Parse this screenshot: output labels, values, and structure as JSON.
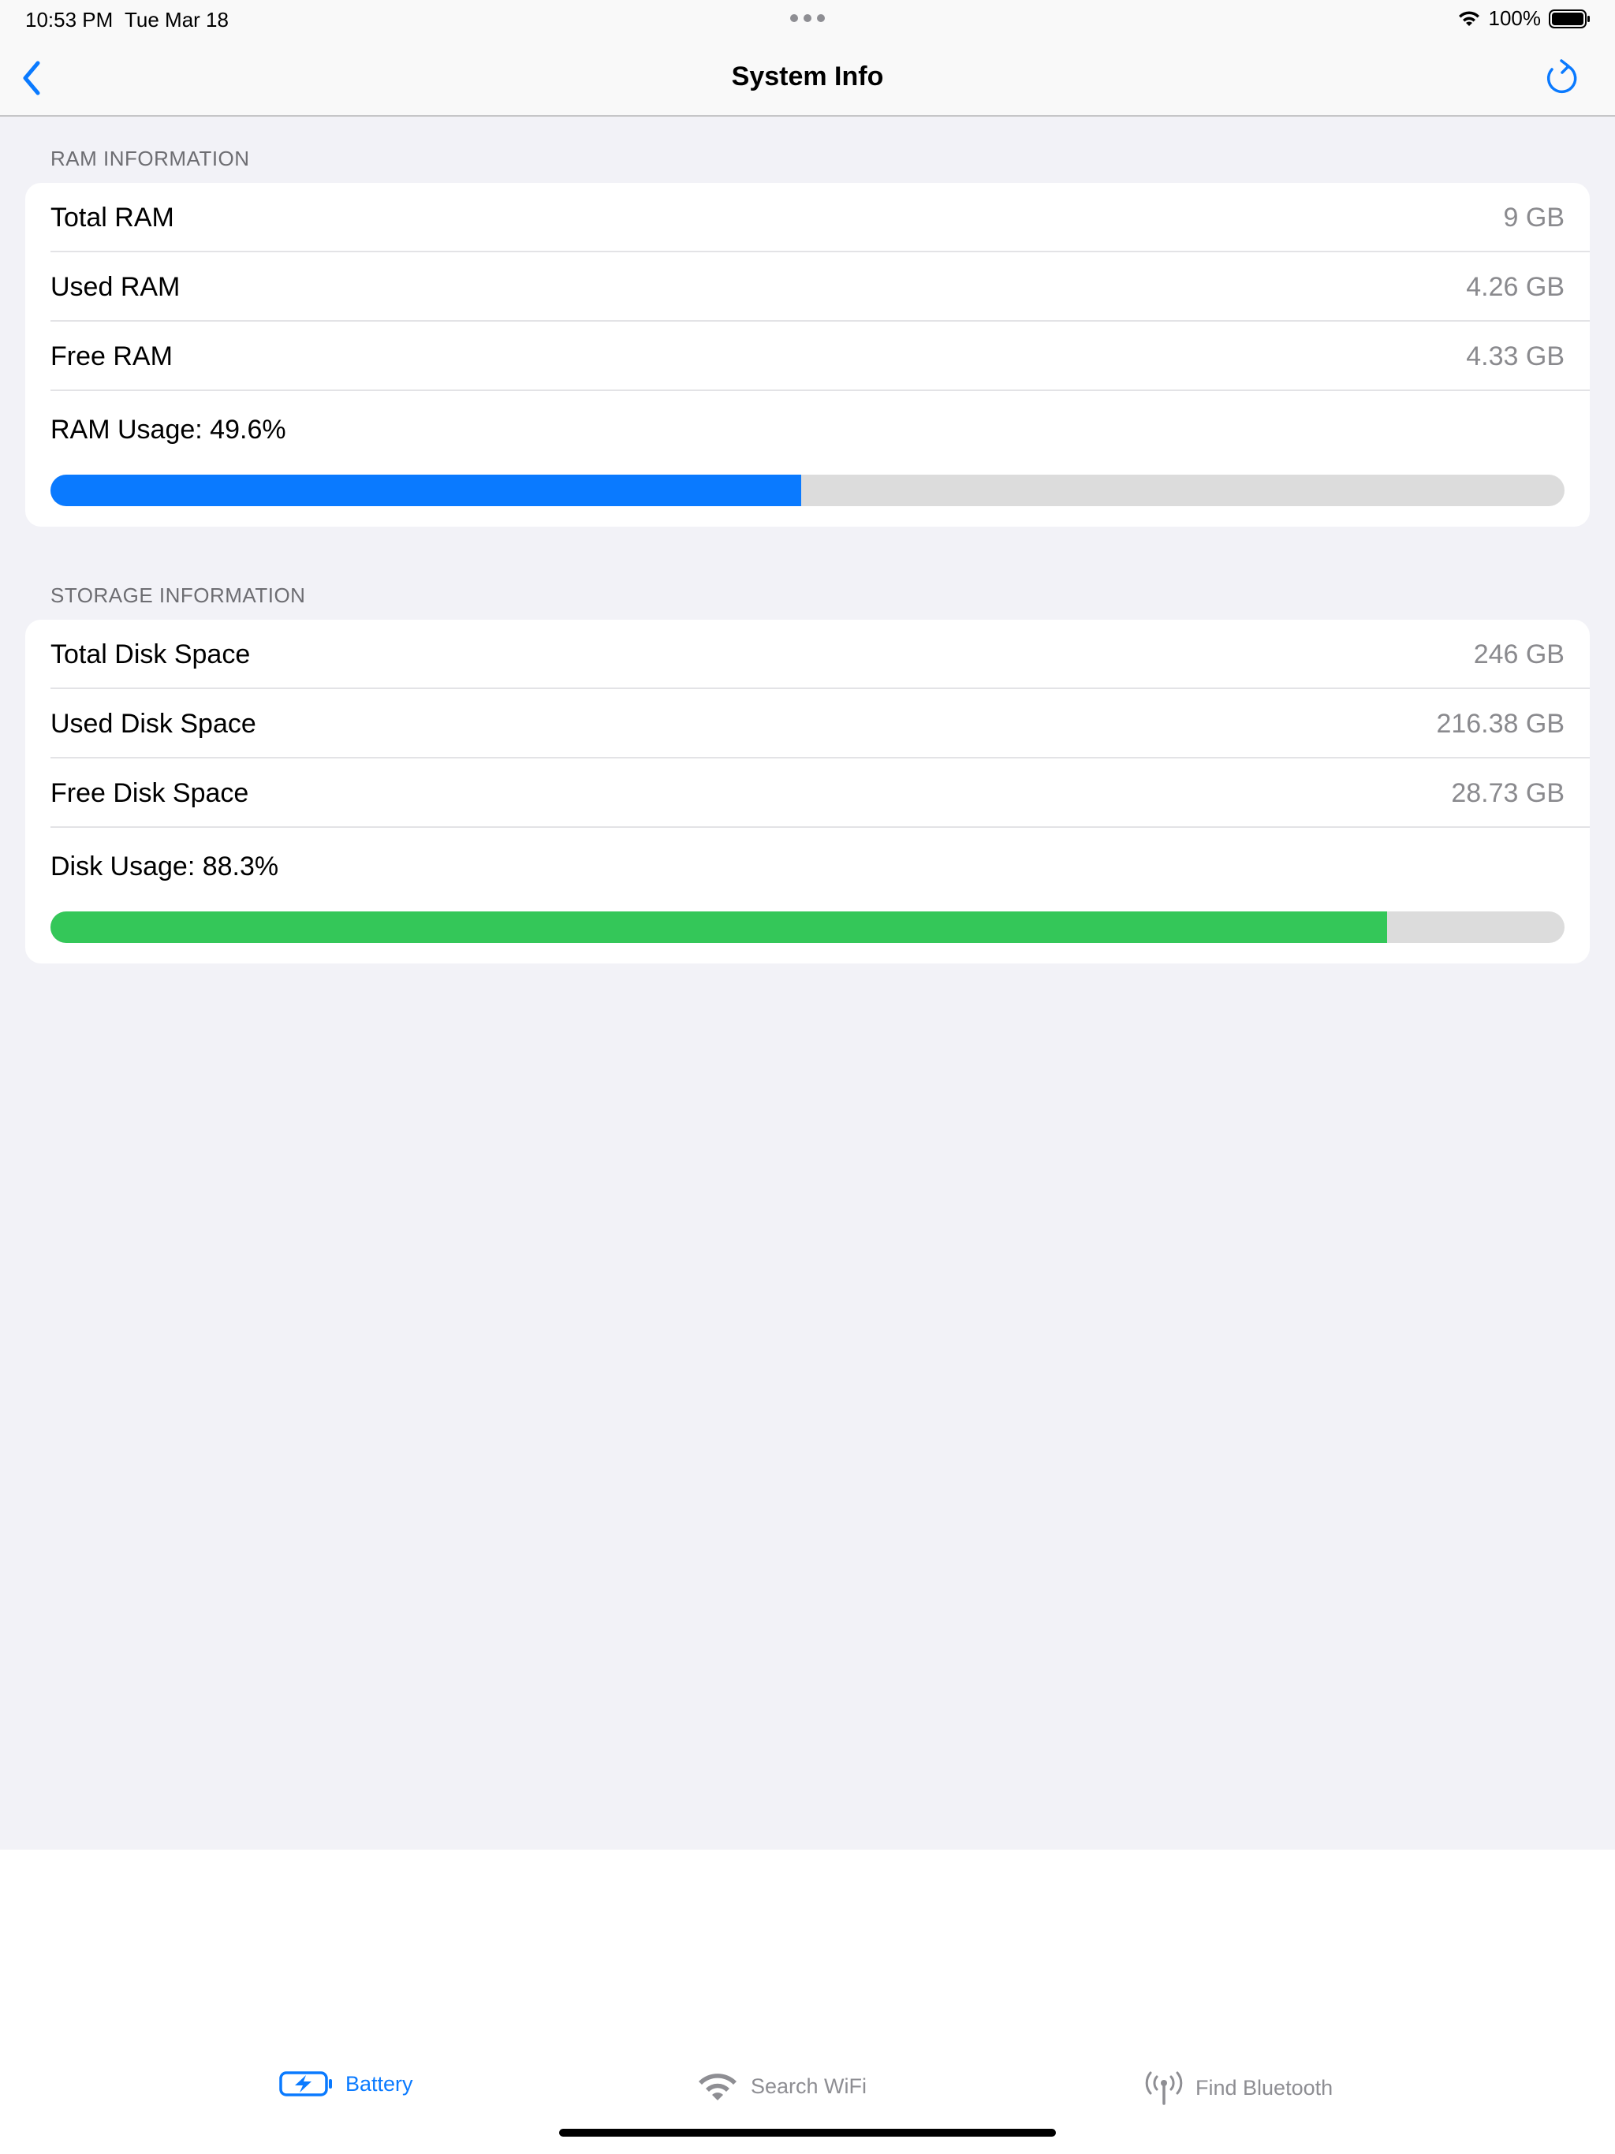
{
  "status_bar": {
    "time": "10:53 PM",
    "date": "Tue Mar 18",
    "battery_percent": "100%"
  },
  "nav": {
    "title": "System Info",
    "back_icon": "chevron-left-icon",
    "refresh_icon": "refresh-icon"
  },
  "ram": {
    "header": "RAM INFORMATION",
    "rows": [
      {
        "label": "Total RAM",
        "value": "9 GB"
      },
      {
        "label": "Used RAM",
        "value": "4.26 GB"
      },
      {
        "label": "Free RAM",
        "value": "4.33 GB"
      }
    ],
    "usage_label": "RAM Usage: 49.6%",
    "usage_fraction": 0.496,
    "bar_color": "#0a7aff"
  },
  "storage": {
    "header": "STORAGE INFORMATION",
    "rows": [
      {
        "label": "Total Disk Space",
        "value": "246 GB"
      },
      {
        "label": "Used Disk Space",
        "value": "216.38 GB"
      },
      {
        "label": "Free Disk Space",
        "value": "28.73 GB"
      }
    ],
    "usage_label": "Disk Usage: 88.3%",
    "usage_fraction": 0.883,
    "bar_color": "#34c759"
  },
  "tabs": [
    {
      "label": "Battery",
      "icon": "battery-charging-icon",
      "active": true
    },
    {
      "label": "Search WiFi",
      "icon": "wifi-icon",
      "active": false
    },
    {
      "label": "Find Bluetooth",
      "icon": "antenna-icon",
      "active": false
    }
  ],
  "colors": {
    "accent": "#0a7aff",
    "inactive_tab": "#8e8e93",
    "background": "#f2f2f7"
  }
}
